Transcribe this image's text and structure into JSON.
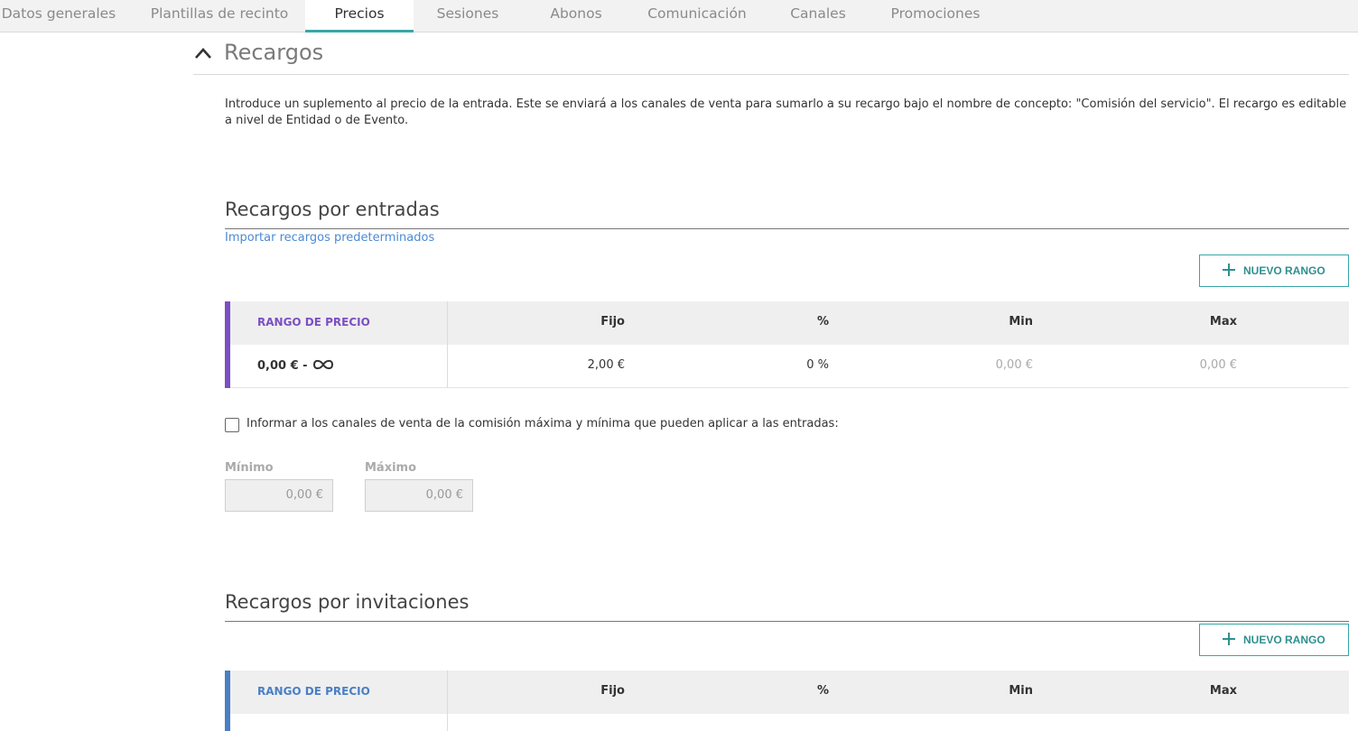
{
  "tabs": [
    {
      "label": "Datos generales"
    },
    {
      "label": "Plantillas de recinto"
    },
    {
      "label": "Precios"
    },
    {
      "label": "Sesiones"
    },
    {
      "label": "Abonos"
    },
    {
      "label": "Comunicación"
    },
    {
      "label": "Canales"
    },
    {
      "label": "Promociones"
    }
  ],
  "active_tab": "Precios",
  "section": {
    "title": "Recargos",
    "icon": "chevron-up-icon",
    "intro": "Introduce un suplemento al precio de la entrada. Este se enviará a los canales de venta para sumarlo a su recargo bajo el nombre de concepto: \"Comisión del servicio\". El recargo es editable a nivel de Entidad o de Evento."
  },
  "entradas": {
    "title": "Recargos por entradas",
    "import_link": "Importar recargos predeterminados",
    "new_range_label": "NUEVO RANGO",
    "accent_color": "#7b4fc4",
    "headers": {
      "range": "RANGO DE PRECIO",
      "fijo": "Fijo",
      "pct": "%",
      "min": "Min",
      "max": "Max"
    },
    "rows": [
      {
        "range": "0,00 € - ",
        "range_icon": "infinity-icon",
        "fijo": "2,00 €",
        "pct": "0 %",
        "min": "0,00 €",
        "max": "0,00 €"
      }
    ],
    "inform_checkbox": {
      "label": "Informar a los canales de venta de la comisión máxima y mínima que pueden aplicar a las entradas:",
      "checked": false
    },
    "minimo": {
      "label": "Mínimo",
      "value": "0,00 €"
    },
    "maximo": {
      "label": "Máximo",
      "value": "0,00 €"
    }
  },
  "invitaciones": {
    "title": "Recargos por invitaciones",
    "new_range_label": "NUEVO RANGO",
    "accent_color": "#4a7fc4",
    "headers": {
      "range": "RANGO DE PRECIO",
      "fijo": "Fijo",
      "pct": "%",
      "min": "Min",
      "max": "Max"
    }
  },
  "colors": {
    "accent_teal": "#3aa6a6",
    "link_blue": "#4a8ad4"
  }
}
